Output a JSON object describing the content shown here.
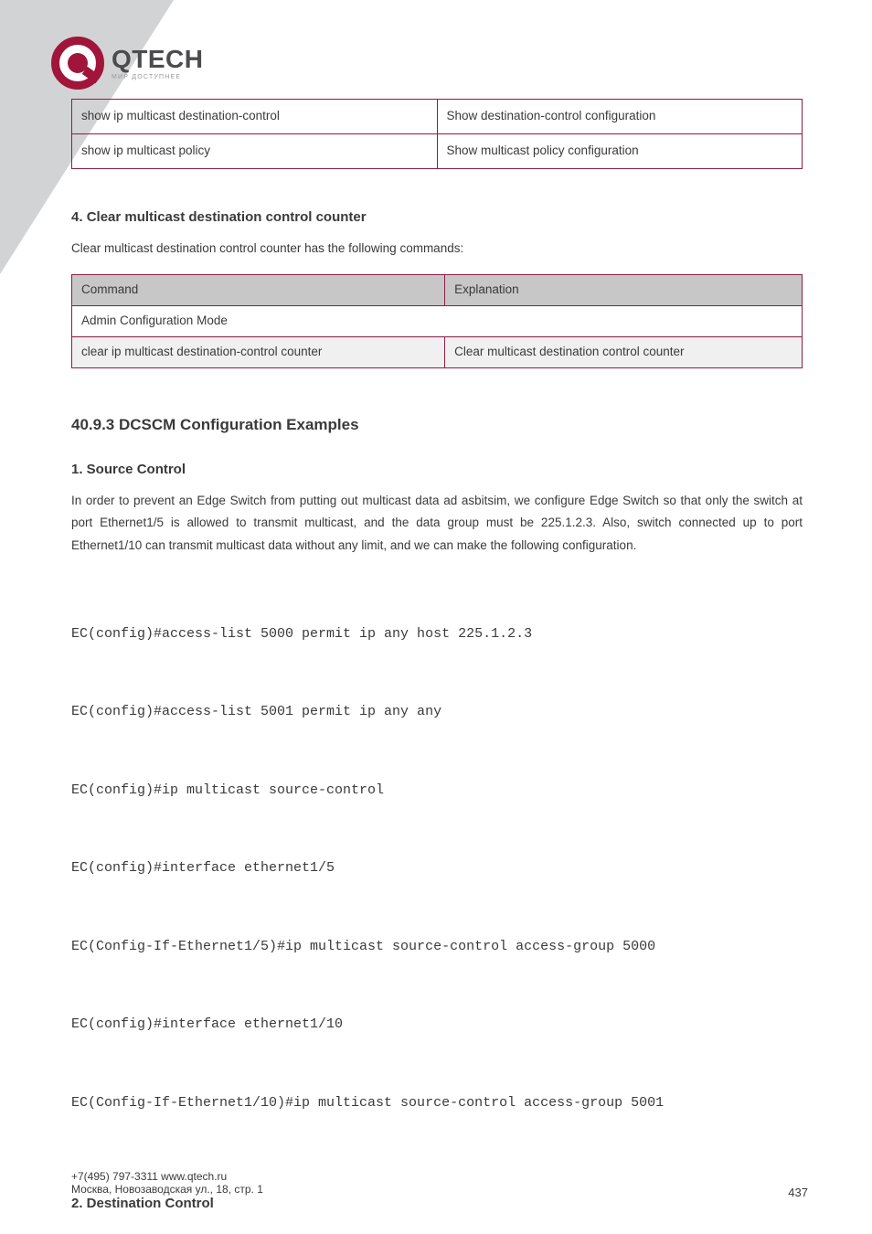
{
  "logo": {
    "brand": "QTECH",
    "tagline": "МИР ДОСТУПНЕЕ"
  },
  "table1": {
    "row1": {
      "left": "show ip multicast destination-control",
      "right": "Show destination-control configuration"
    },
    "row2": {
      "left": "show ip multicast policy",
      "right": "Show multicast policy configuration"
    }
  },
  "section": {
    "number": "4.",
    "title": "Clear multicast destination control counter",
    "intro_prefix": "Clear multicast destination control counter has the following commands:",
    "table2": {
      "col_cmd": "Command",
      "col_exp": "Explanation",
      "mode_row": "Admin Configuration Mode",
      "cmd": "clear ip multicast destination-control counter",
      "exp": "Clear multicast destination control counter"
    }
  },
  "heading_examples": "40.9.3 DCSCM Configuration Examples",
  "sub_source": "1. Source Control",
  "paragraph": "In order to prevent an Edge Switch from putting out multicast data ad asbitsim, we configure Edge Switch so that only the switch at port Ethernet1/5 is allowed to transmit multicast, and the data group must be 225.1.2.3. Also, switch connected up to port Ethernet1/10 can transmit multicast data without any limit, and we can make the following configuration.",
  "code": [
    "EC(config)#access-list 5000 permit ip any host 225.1.2.3",
    "EC(config)#access-list 5001 permit ip any any",
    "EC(config)#ip multicast source-control",
    "EC(config)#interface ethernet1/5",
    "EC(Config-If-Ethernet1/5)#ip multicast source-control access-group 5000",
    "EC(config)#interface ethernet1/10",
    "EC(Config-If-Ethernet1/10)#ip multicast source-control access-group 5001"
  ],
  "sub_dest": "2. Destination Control",
  "footer_left": "+7(495) 797-3311 www.qtech.ru",
  "footer_addr": "Москва, Новозаводская ул., 18, стр. 1",
  "page_num": "437"
}
